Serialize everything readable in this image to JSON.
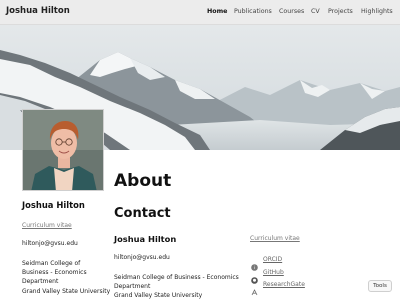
{
  "navbar": {
    "brand": "Joshua Hilton",
    "links": [
      {
        "label": "Home",
        "active": true
      },
      {
        "label": "Publications",
        "active": false
      },
      {
        "label": "Courses",
        "active": false
      },
      {
        "label": "CV",
        "active": false
      },
      {
        "label": "Projects",
        "active": false
      },
      {
        "label": "Highlights",
        "active": false
      }
    ]
  },
  "sidebar": {
    "name": "Joshua Hilton",
    "cv_link": "Curriculum vitae",
    "email": "hiltonjo@gvsu.edu",
    "affiliation": [
      "Seidman College of",
      "Business - Economics",
      "Department",
      "Grand Valley State University"
    ]
  },
  "main": {
    "about_heading": "About",
    "contact_heading": "Contact",
    "name": "Joshua Hilton",
    "email": "hiltonjo@gvsu.edu",
    "affiliation": [
      "Seidman College of Business - Economics",
      "Department",
      "Grand Valley State University"
    ],
    "cv_link": "Curriculum vitae",
    "social": [
      {
        "label": "ORCID",
        "icon": "orcid-icon"
      },
      {
        "label": "GitHub",
        "icon": "github-icon"
      },
      {
        "label": "ResearchGate",
        "icon": "researchgate-icon"
      }
    ]
  },
  "tools_button": "Tools",
  "colors": {
    "navbar_bg": "#ececec",
    "link_gray": "#777777",
    "text": "#222222"
  }
}
